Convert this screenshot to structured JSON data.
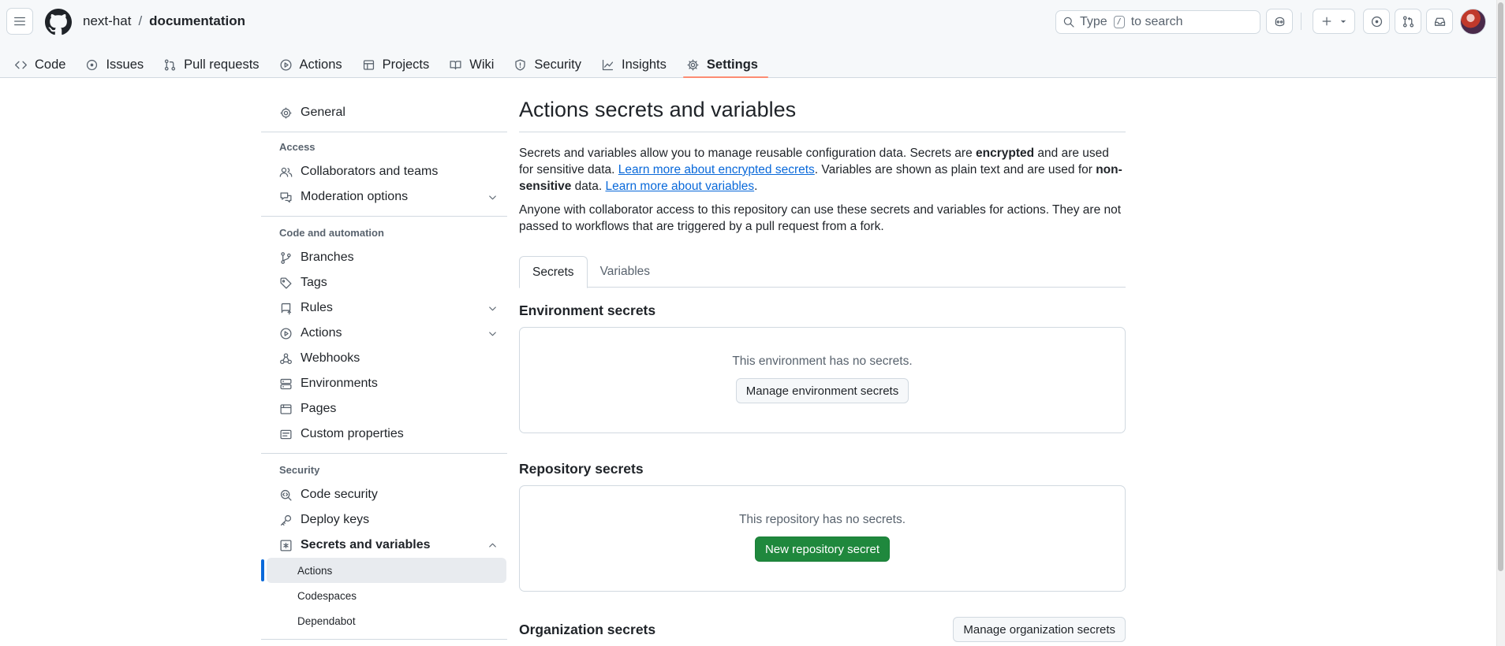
{
  "header": {
    "owner": "next-hat",
    "separator": "/",
    "repo": "documentation",
    "search_prefix": "Type",
    "search_key": "/",
    "search_suffix": "to search"
  },
  "repo_tabs": [
    {
      "label": "Code",
      "icon": "code-icon"
    },
    {
      "label": "Issues",
      "icon": "issue-opened-icon"
    },
    {
      "label": "Pull requests",
      "icon": "git-pull-request-icon"
    },
    {
      "label": "Actions",
      "icon": "play-icon"
    },
    {
      "label": "Projects",
      "icon": "table-icon"
    },
    {
      "label": "Wiki",
      "icon": "book-icon"
    },
    {
      "label": "Security",
      "icon": "shield-icon"
    },
    {
      "label": "Insights",
      "icon": "graph-icon"
    },
    {
      "label": "Settings",
      "icon": "gear-icon",
      "selected": true
    }
  ],
  "sidebar": {
    "general": "General",
    "access_title": "Access",
    "collaborators": "Collaborators and teams",
    "moderation": "Moderation options",
    "code_title": "Code and automation",
    "branches": "Branches",
    "tags": "Tags",
    "rules": "Rules",
    "actions": "Actions",
    "webhooks": "Webhooks",
    "environments": "Environments",
    "pages": "Pages",
    "custom_properties": "Custom properties",
    "security_title": "Security",
    "code_security": "Code security",
    "deploy_keys": "Deploy keys",
    "secrets_variables": "Secrets and variables",
    "sub_actions": "Actions",
    "sub_codespaces": "Codespaces",
    "sub_dependabot": "Dependabot"
  },
  "main": {
    "title": "Actions secrets and variables",
    "p1_a": "Secrets and variables allow you to manage reusable configuration data. Secrets are ",
    "p1_b": "encrypted",
    "p1_c": " and are used for sensitive data. ",
    "p1_link1": "Learn more about encrypted secrets",
    "p1_d": ". Variables are shown as plain text and are used for ",
    "p1_e": "non-sensitive",
    "p1_f": " data. ",
    "p1_link2": "Learn more about variables",
    "p1_g": ".",
    "p2": "Anyone with collaborator access to this repository can use these secrets and variables for actions. They are not passed to workflows that are triggered by a pull request from a fork.",
    "tab_secrets": "Secrets",
    "tab_variables": "Variables",
    "env_title": "Environment secrets",
    "env_empty": "This environment has no secrets.",
    "env_button": "Manage environment secrets",
    "repo_title": "Repository secrets",
    "repo_empty": "This repository has no secrets.",
    "repo_button": "New repository secret",
    "org_title": "Organization secrets",
    "org_button": "Manage organization secrets"
  },
  "colors": {
    "accent": "#0969da",
    "primary_button": "#1f883d",
    "tab_underline": "#fd8c73"
  }
}
